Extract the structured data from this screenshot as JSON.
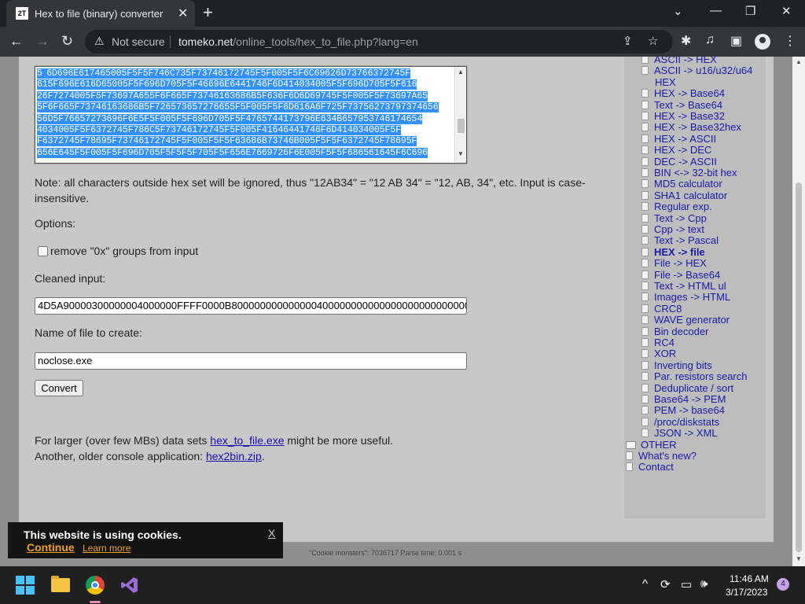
{
  "tab": {
    "favicon": "2T",
    "title": "Hex to file (binary) converter"
  },
  "omnibox": {
    "security": "Not secure",
    "host": "tomeko.net",
    "path": "/online_tools/hex_to_file.php?lang=en"
  },
  "page": {
    "hex_lines": [
      "5   6D696E617465005F5F5F746C735F73746172745F5F005F5F6C69626D73766372745F",
      "615F696E616D65005F5F696D705F5F46696E6441746F6D414034005F5F696D705F5F616",
      "26F7274005F5F73697A655F6F665F73746163686B5F636F6D6D69745F5F005F5F73697A65",
      "5F6F665F73746163686B5F726573657276655F5F005F5F6D616A6F725F73756273797374656",
      "56D5F76657273696F6E5F5F005F5F696D705F5F4765744173796E634B657953746174654",
      "4034005F5F6372745F786C5F73746172745F5F005F41646441746F6D414034005F5F",
      "F6372745F78695F73746172745F5F005F5F5F63686B73746B005F5F5F6372745F78695F",
      "656E645F5F005F5F696D705F5F5F5F705F5F656E7669726F6E005F5F5F686561645F6C696"
    ],
    "note": "Note: all characters outside hex set will be ignored, thus \"12AB34\" = \"12 AB 34\" = \"12, AB, 34\", etc. Input is case-insensitive.",
    "options_label": "Options:",
    "remove0x_label": "remove \"0x\" groups from input",
    "remove0x_checked": false,
    "cleaned_label": "Cleaned input:",
    "cleaned_value": "4D5A90000300000004000000FFFF0000B800000000000000400000000000000000000000000000",
    "filename_label": "Name of file to create:",
    "filename_value": "noclose.exe",
    "convert_label": "Convert",
    "larger_prefix": "For larger (over few MBs) data sets ",
    "larger_link": "hex_to_file.exe",
    "larger_suffix": " might be more useful.",
    "older_prefix": "Another, older console application: ",
    "older_link": "hex2bin.zip",
    "older_suffix": "."
  },
  "sidebar": {
    "items": [
      {
        "label": "ASCII -> HEX",
        "icon": "doc"
      },
      {
        "label": "ASCII -> u16/u32/u64",
        "icon": "doc"
      },
      {
        "label": "HEX",
        "icon": "none"
      },
      {
        "label": "HEX -> Base64",
        "icon": "doc"
      },
      {
        "label": "Text -> Base64",
        "icon": "doc"
      },
      {
        "label": "HEX -> Base32",
        "icon": "doc"
      },
      {
        "label": "HEX -> Base32hex",
        "icon": "doc"
      },
      {
        "label": "HEX -> ASCII",
        "icon": "doc"
      },
      {
        "label": "HEX -> DEC",
        "icon": "doc"
      },
      {
        "label": "DEC -> ASCII",
        "icon": "doc"
      },
      {
        "label": "BIN <-> 32-bit hex",
        "icon": "doc"
      },
      {
        "label": "MD5 calculator",
        "icon": "doc"
      },
      {
        "label": "SHA1 calculator",
        "icon": "doc"
      },
      {
        "label": "Regular exp.",
        "icon": "doc"
      },
      {
        "label": "Text -> Cpp",
        "icon": "doc"
      },
      {
        "label": "Cpp -> text",
        "icon": "doc"
      },
      {
        "label": "Text -> Pascal",
        "icon": "doc"
      },
      {
        "label": "HEX -> file",
        "icon": "doc",
        "current": true
      },
      {
        "label": "File -> HEX",
        "icon": "doc"
      },
      {
        "label": "File -> Base64",
        "icon": "doc"
      },
      {
        "label": "Text -> HTML ul",
        "icon": "doc"
      },
      {
        "label": "Images -> HTML",
        "icon": "doc"
      },
      {
        "label": "CRC8",
        "icon": "doc"
      },
      {
        "label": "WAVE generator",
        "icon": "doc"
      },
      {
        "label": "Bin decoder",
        "icon": "doc"
      },
      {
        "label": "RC4",
        "icon": "doc"
      },
      {
        "label": "XOR",
        "icon": "doc"
      },
      {
        "label": "Inverting bits",
        "icon": "doc"
      },
      {
        "label": "Par. resistors search",
        "icon": "doc"
      },
      {
        "label": "Deduplicate / sort",
        "icon": "doc"
      },
      {
        "label": "Base64 -> PEM",
        "icon": "doc"
      },
      {
        "label": "PEM -> base64",
        "icon": "doc"
      },
      {
        "label": "/proc/diskstats",
        "icon": "doc"
      },
      {
        "label": "JSON -> XML",
        "icon": "doc"
      },
      {
        "label": "OTHER",
        "icon": "folder",
        "level": 0
      },
      {
        "label": "What's new?",
        "icon": "doc",
        "level": 0
      },
      {
        "label": "Contact",
        "icon": "doc",
        "level": 0
      }
    ]
  },
  "cookie": {
    "title": "This website is using cookies.",
    "close": "X",
    "continue": "Continue",
    "learn_more": "Learn more"
  },
  "footer": {
    "text": "\"Cookie monsters\": 7036717     Parse time: 0.001 s"
  },
  "taskbar": {
    "time": "11:46 AM",
    "date": "3/17/2023",
    "notifications": "4"
  },
  "colors": {
    "selection": "#3390ff",
    "link": "#1a0dab",
    "sidebar_link": "#1a1aa6",
    "page_bg": "#c8c8c8",
    "cookie_accent": "#f0a020"
  }
}
